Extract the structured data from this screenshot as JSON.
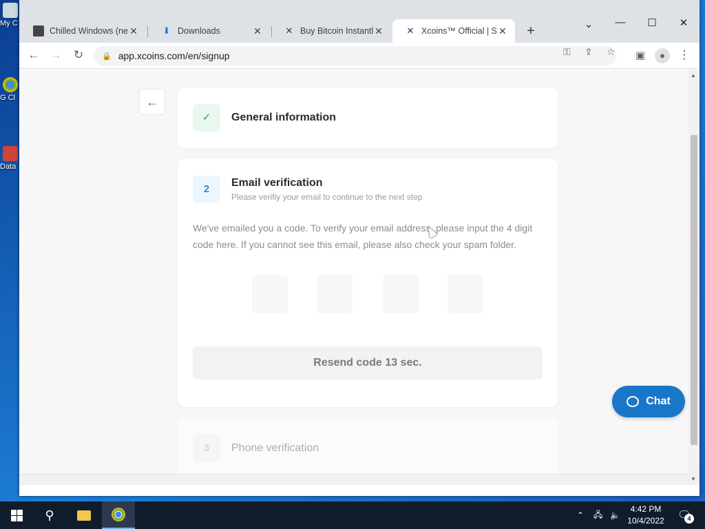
{
  "desktop": {
    "icons": [
      {
        "label": "My C"
      },
      {
        "label": "G Cl"
      },
      {
        "label": "Data"
      }
    ]
  },
  "browser": {
    "tabs": [
      {
        "title": "Chilled Windows (new",
        "icon": "video-thumbnail-icon"
      },
      {
        "title": "Downloads",
        "icon": "download-icon"
      },
      {
        "title": "Buy Bitcoin Instantly",
        "icon": "xcoins-logo-icon"
      },
      {
        "title": "Xcoins™ Official | Sig",
        "icon": "xcoins-logo-icon",
        "active": true
      }
    ],
    "url": "app.xcoins.com/en/signup"
  },
  "page": {
    "steps": [
      {
        "number": "✓",
        "title": "General information",
        "status": "complete"
      },
      {
        "number": "2",
        "title": "Email verification",
        "subtitle": "Please verifiy your email to continue to the next step",
        "status": "active"
      },
      {
        "number": "3",
        "title": "Phone verification",
        "status": "pending"
      }
    ],
    "description": "We've emailed you a code. To verify your email address, please input the 4 digit code here. If you cannot see this email, please also check your spam folder.",
    "code_inputs": [
      "",
      "",
      "",
      ""
    ],
    "resend_label": "Resend code 13 sec.",
    "chat_label": "Chat"
  },
  "taskbar": {
    "time": "4:42 PM",
    "date": "10/4/2022",
    "notification_count": "4"
  },
  "colors": {
    "accent": "#1877c9",
    "complete_badge_bg": "#e9f8ee",
    "complete_check": "#2e9e5b",
    "active_badge_bg": "#eef6fd",
    "active_number": "#2a8ed8"
  }
}
